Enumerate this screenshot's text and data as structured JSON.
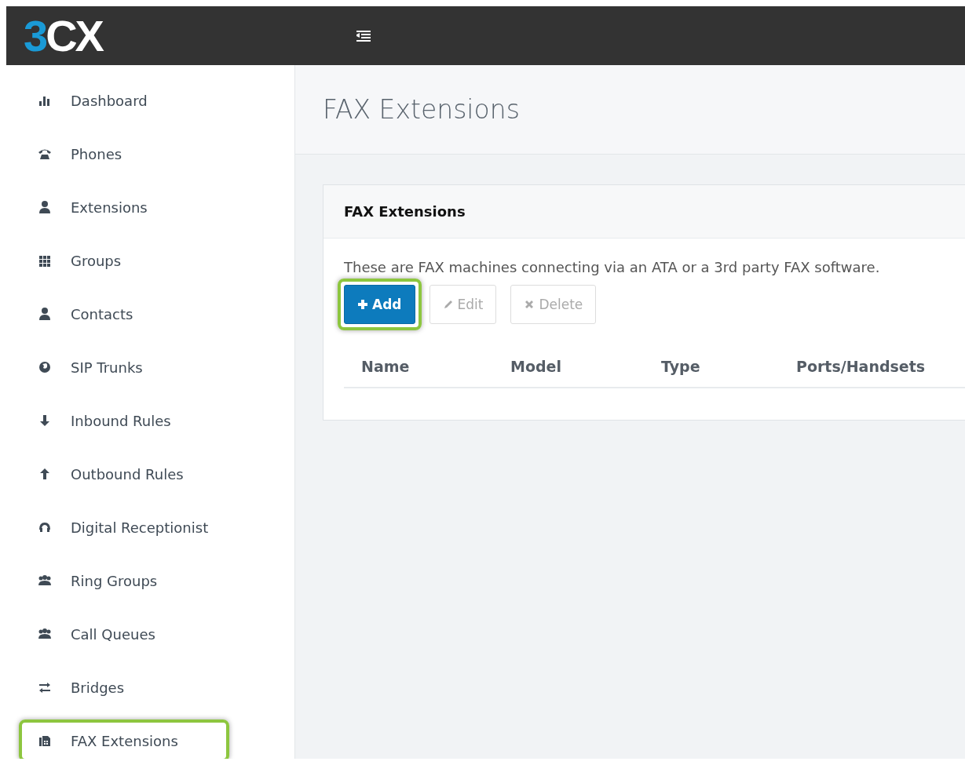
{
  "logo": {
    "accent": "3",
    "rest": "CX"
  },
  "sidebar": {
    "items": [
      {
        "label": "Dashboard",
        "highlighted": false
      },
      {
        "label": "Phones",
        "highlighted": false
      },
      {
        "label": "Extensions",
        "highlighted": false
      },
      {
        "label": "Groups",
        "highlighted": false
      },
      {
        "label": "Contacts",
        "highlighted": false
      },
      {
        "label": "SIP Trunks",
        "highlighted": false
      },
      {
        "label": "Inbound Rules",
        "highlighted": false
      },
      {
        "label": "Outbound Rules",
        "highlighted": false
      },
      {
        "label": "Digital Receptionist",
        "highlighted": false
      },
      {
        "label": "Ring Groups",
        "highlighted": false
      },
      {
        "label": "Call Queues",
        "highlighted": false
      },
      {
        "label": "Bridges",
        "highlighted": false
      },
      {
        "label": "FAX Extensions",
        "highlighted": true
      }
    ]
  },
  "page_title": "FAX Extensions",
  "panel": {
    "title": "FAX Extensions",
    "description": "These are FAX machines connecting via an ATA or a 3rd party FAX software.",
    "buttons": [
      {
        "label": "Add",
        "disabled": false,
        "highlighted": true
      },
      {
        "label": "Edit",
        "disabled": true,
        "highlighted": false
      },
      {
        "label": "Delete",
        "disabled": true,
        "highlighted": false
      }
    ],
    "table": {
      "columns": [
        "Name",
        "Model",
        "Type",
        "Ports/Handsets"
      ]
    }
  }
}
